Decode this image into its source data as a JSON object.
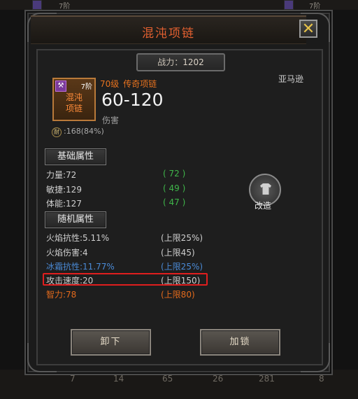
{
  "top_strip": {
    "left_level": "7阶",
    "right_level": "7阶"
  },
  "dialog": {
    "title": "混沌项链",
    "close_label": "✕",
    "power_label": "战力：",
    "power_value": "1202"
  },
  "item": {
    "icon_name": "混沌\n项链",
    "rank": "7阶",
    "level_text": "70级",
    "type_text": "传奇项链",
    "race": "亚马逊",
    "damage": "60-120",
    "damage_label": "伤害",
    "durability_icon": "耐",
    "durability_text": ":168(84%)"
  },
  "base_attrs": {
    "header": "基础属性",
    "rows": [
      {
        "name": "力量:72",
        "bonus": "( 72 )"
      },
      {
        "name": "敏捷:129",
        "bonus": "( 49 )"
      },
      {
        "name": "体能:127",
        "bonus": "( 47 )"
      }
    ]
  },
  "random_attrs": {
    "header": "随机属性",
    "rows": [
      {
        "name": "火焰抗性:5.11%",
        "cap": "(上限25%)"
      },
      {
        "name": "火焰伤害:4",
        "cap": "(上限45)"
      },
      {
        "name": "冰霜抗性:11.77%",
        "cap": "(上限25%)"
      },
      {
        "name": "攻击速度:20",
        "cap": "(上限150)"
      },
      {
        "name": "智力:78",
        "cap": "(上限80)"
      }
    ]
  },
  "reforge": {
    "label": "改造"
  },
  "buttons": {
    "unequip": "卸下",
    "lock": "加锁"
  },
  "bottom_strip": {
    "values": [
      "7",
      "14",
      "65",
      "26",
      "281",
      "8"
    ]
  },
  "colors": {
    "title": "#e36030",
    "legendary": "#e8731f",
    "bonus_green": "#3fb64a",
    "blue_attr": "#4a8ad6",
    "orange_attr": "#e36a1c",
    "highlight": "#e01e1e"
  }
}
